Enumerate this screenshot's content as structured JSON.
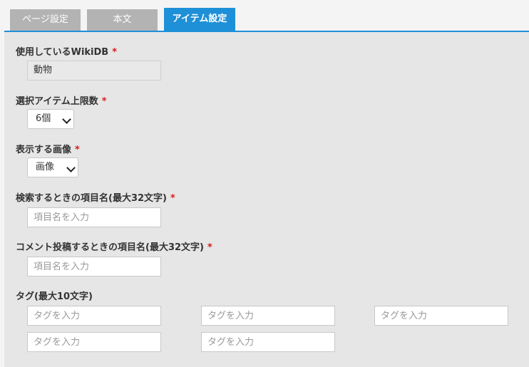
{
  "tabs": [
    {
      "label": "ページ設定"
    },
    {
      "label": "本文"
    },
    {
      "label": "アイテム設定"
    }
  ],
  "required_mark": "*",
  "fields": {
    "wikidb": {
      "label": "使用しているWikiDB",
      "value": "動物"
    },
    "max_items": {
      "label": "選択アイテム上限数",
      "selected": "6個"
    },
    "image": {
      "label": "表示する画像",
      "selected": "画像"
    },
    "search_name": {
      "label": "検索するときの項目名(最大32文字)",
      "placeholder": "項目名を入力"
    },
    "comment_name": {
      "label": "コメント投稿するときの項目名(最大32文字)",
      "placeholder": "項目名を入力"
    },
    "tags": {
      "label": "タグ(最大10文字)",
      "inputs": [
        {
          "placeholder": "タグを入力"
        },
        {
          "placeholder": "タグを入力"
        },
        {
          "placeholder": "タグを入力"
        },
        {
          "placeholder": "タグを入力"
        },
        {
          "placeholder": "タグを入力"
        }
      ]
    }
  },
  "colors": {
    "accent": "#1e90d8",
    "tab_inactive": "#b3b3b3",
    "required": "#d61c1c",
    "panel": "#e6e6e6"
  }
}
